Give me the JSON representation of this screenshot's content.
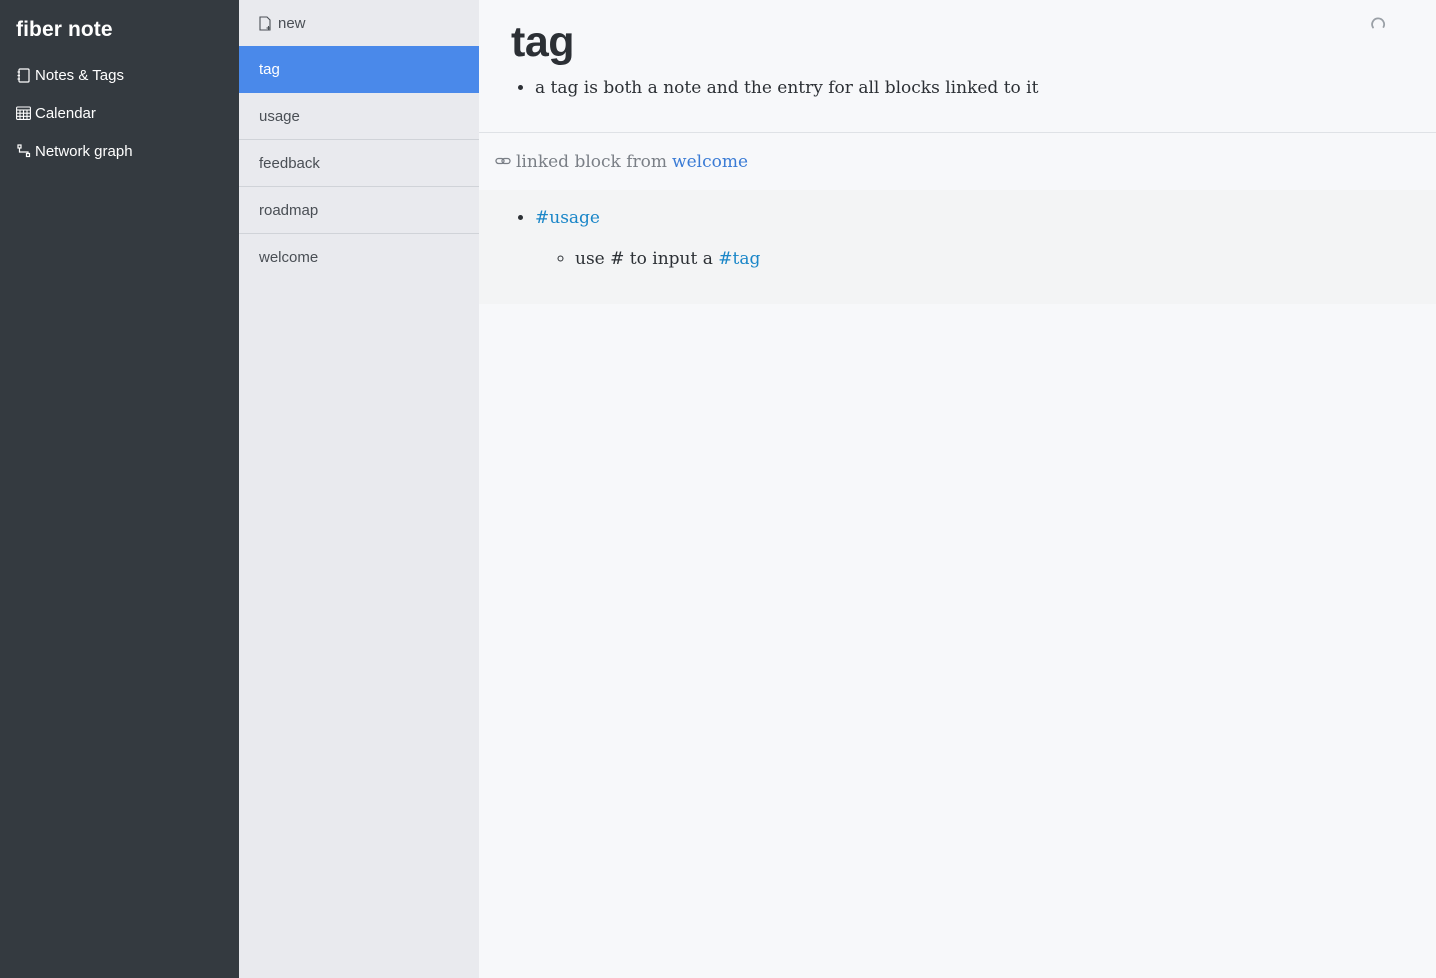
{
  "app": {
    "title": "fiber note"
  },
  "sidebar": {
    "items": [
      {
        "label": "Notes & Tags",
        "icon": "notebook-icon"
      },
      {
        "label": "Calendar",
        "icon": "calendar-icon"
      },
      {
        "label": "Network graph",
        "icon": "network-graph-icon"
      }
    ]
  },
  "notelist": {
    "new_label": "new",
    "items": [
      {
        "label": "tag",
        "active": true
      },
      {
        "label": "usage",
        "active": false
      },
      {
        "label": "feedback",
        "active": false
      },
      {
        "label": "roadmap",
        "active": false
      },
      {
        "label": "welcome",
        "active": false
      }
    ]
  },
  "note": {
    "title": "tag",
    "blocks": [
      "a tag is both a note and the entry for all blocks linked to it"
    ]
  },
  "linked": {
    "prefix": "linked block from",
    "source": "welcome",
    "parent_tag": "#usage",
    "child_text": "use # to input a",
    "child_tag": "#tag"
  },
  "colors": {
    "sidebar_bg": "#343a40",
    "notelist_bg": "#e9eaee",
    "active_item": "#4a89ea",
    "tag_link": "#1a86c8"
  }
}
